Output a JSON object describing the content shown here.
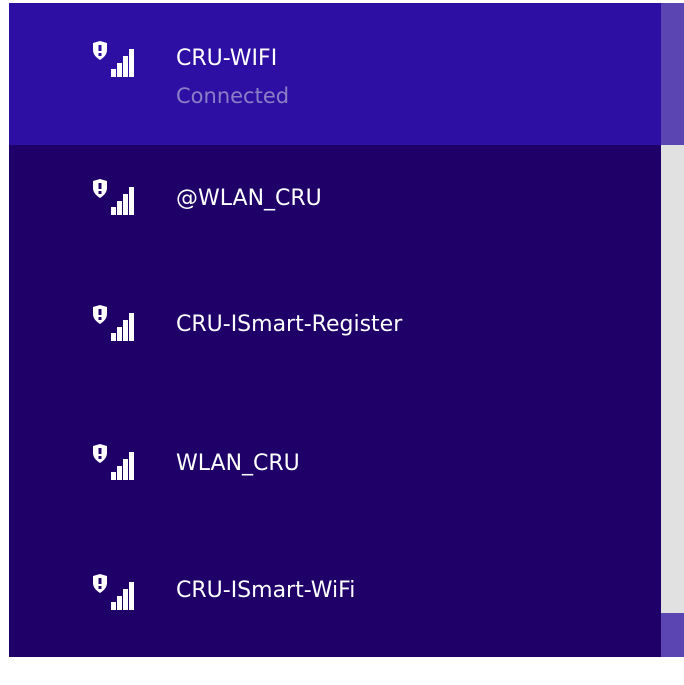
{
  "networks": [
    {
      "name": "CRU-WIFI",
      "status": "Connected",
      "secured": true,
      "icon": "wifi-secured-icon"
    },
    {
      "name": "@WLAN_CRU",
      "secured": true,
      "icon": "wifi-secured-icon"
    },
    {
      "name": "CRU-ISmart-Register",
      "secured": true,
      "icon": "wifi-secured-icon"
    },
    {
      "name": "WLAN_CRU",
      "secured": true,
      "icon": "wifi-secured-icon"
    },
    {
      "name": "CRU-ISmart-WiFi",
      "secured": true,
      "icon": "wifi-secured-icon"
    }
  ],
  "colors": {
    "panel_bg": "#1f0068",
    "connected_bg": "#2e0fa3",
    "status_text": "#8a7fc7",
    "scrollbar_track": "#e1e1e1",
    "scrollbar_accent": "#5b45b3"
  }
}
